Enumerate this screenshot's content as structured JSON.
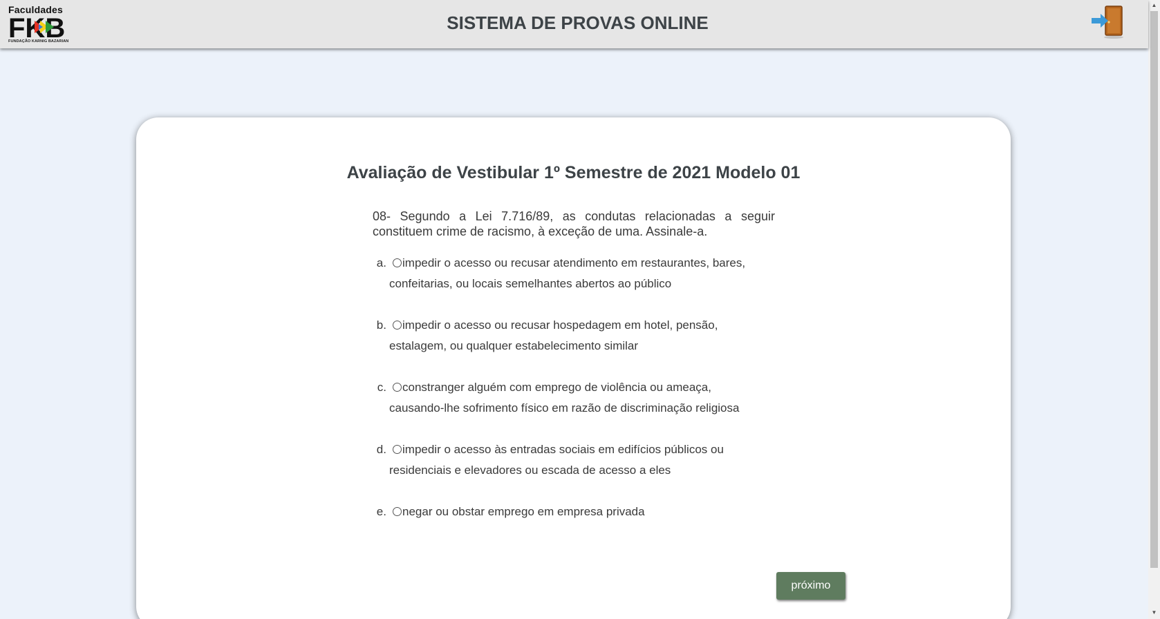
{
  "header": {
    "logo_text_top": "Faculdades",
    "logo_text_mark": "FKB",
    "logo_text_sub": "FUNDAÇÃO KARNIG BAZARIAN",
    "title": "SISTEMA DE PROVAS ONLINE",
    "exit_icon": "exit-door-icon"
  },
  "exam": {
    "title": "Avaliação de Vestibular 1º Semestre de 2021 Modelo 01",
    "question": "08- Segundo a Lei 7.716/89, as condutas relacionadas a seguir constituem crime de racismo, à exceção de uma. Assinale-a.",
    "options": [
      {
        "letter": "a",
        "text": "impedir o acesso ou recusar atendimento em restaurantes, bares, confeitarias, ou locais semelhantes abertos ao público",
        "selected": false
      },
      {
        "letter": "b",
        "text": "impedir o acesso ou recusar hospedagem em hotel, pensão, estalagem, ou qualquer estabelecimento similar",
        "selected": false
      },
      {
        "letter": "c",
        "text": "constranger alguém com emprego de violência ou ameaça, causando-lhe sofrimento físico em razão de discriminação religiosa",
        "selected": false
      },
      {
        "letter": "d",
        "text": "impedir o acesso às entradas sociais em edifícios públicos ou residenciais e elevadores ou escada de acesso a eles",
        "selected": false
      },
      {
        "letter": "e",
        "text": "negar ou obstar emprego em empresa privada",
        "selected": false
      }
    ],
    "next_label": "próximo"
  },
  "colors": {
    "header_bg": "#e6e6e6",
    "page_bg": "#ecf2fa",
    "next_button": "#5f7c5f",
    "title_text": "#3d4347"
  }
}
